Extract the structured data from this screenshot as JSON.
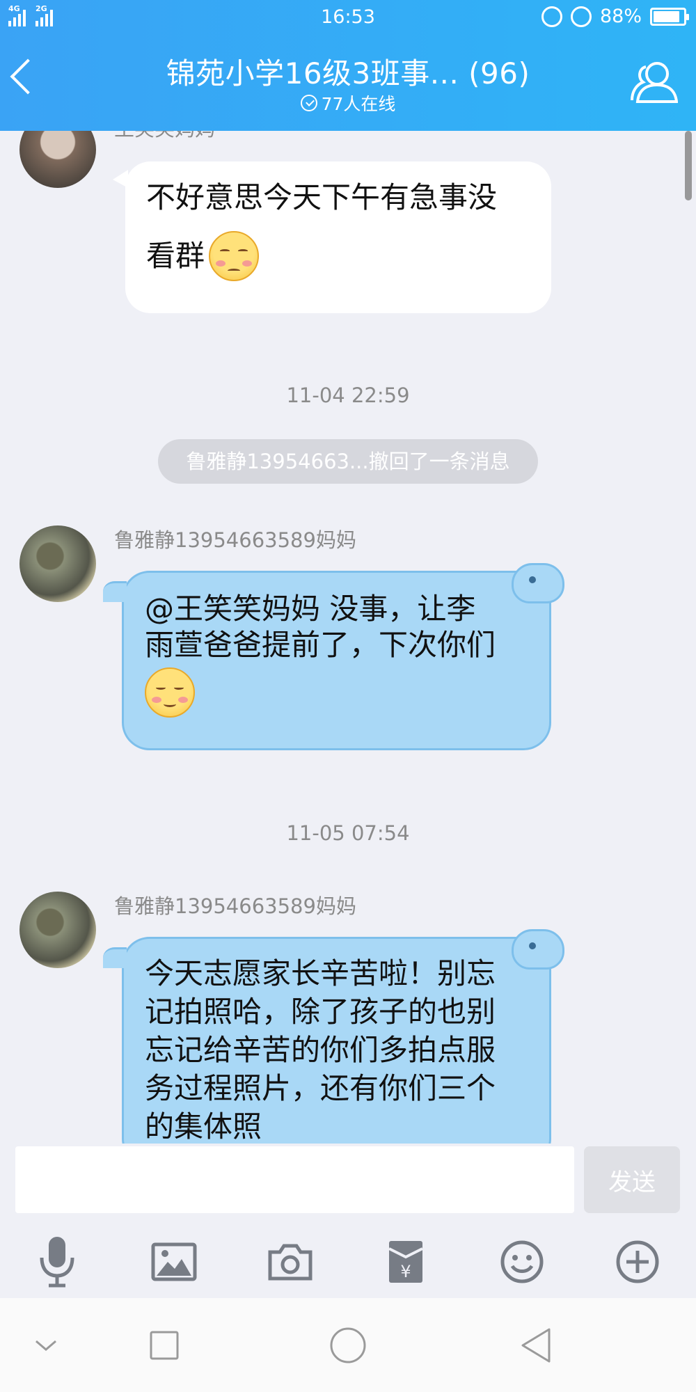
{
  "status_bar": {
    "net1": "4G",
    "net2": "2G",
    "time": "16:53",
    "battery": "88%",
    "battery_level": 0.88
  },
  "header": {
    "title": "锦苑小学16级3班事... (96)",
    "online": "77人在线"
  },
  "messages": [
    {
      "sender": "王笑笑妈妈",
      "text_line1": "不好意思今天下午有急事没",
      "text_line2": "看群"
    },
    {
      "timestamp": "11-04 22:59"
    },
    {
      "recall": "鲁雅静13954663...撤回了一条消息"
    },
    {
      "sender": "鲁雅静13954663589妈妈",
      "text_line1": "@王笑笑妈妈 没事，让李",
      "text_line2": "雨萱爸爸提前了，下次你们"
    },
    {
      "timestamp": "11-05 07:54"
    },
    {
      "sender": "鲁雅静13954663589妈妈",
      "text_line1": "今天志愿家长辛苦啦！别忘",
      "text_line2": "记拍照哈，除了孩子的也别",
      "text_line3": "忘记给辛苦的你们多拍点服",
      "text_line4": "务过程照片，还有你们三个",
      "text_line5": "的集体照"
    }
  ],
  "input": {
    "placeholder": "",
    "send_label": "发送"
  },
  "toolbar": [
    "microphone-icon",
    "image-icon",
    "camera-icon",
    "red-packet-icon",
    "emoji-icon",
    "plus-icon"
  ],
  "accent": "#35a9f5"
}
